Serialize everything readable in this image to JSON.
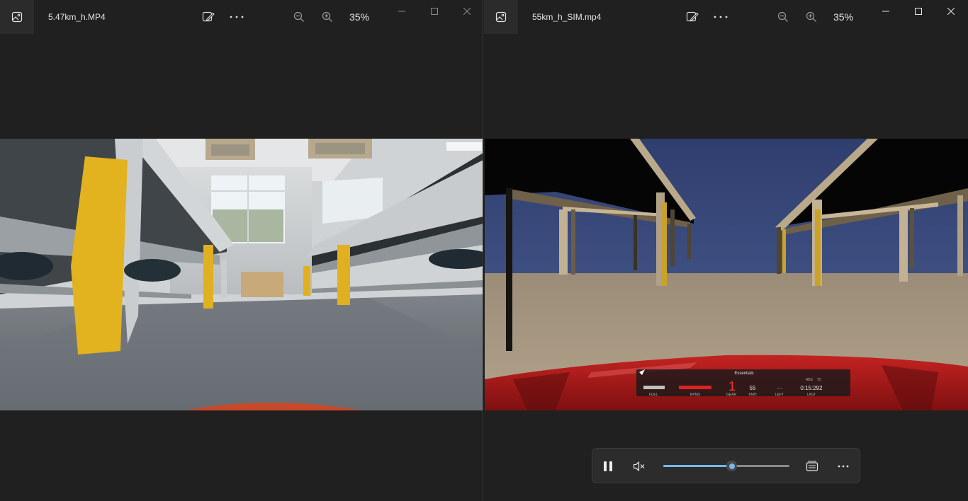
{
  "left_window": {
    "title": "5.47km_h.MP4",
    "zoom": "35%"
  },
  "right_window": {
    "title": "55km_h_SIM.mp4",
    "zoom": "35%",
    "hud": {
      "header": "Essentials",
      "gear": "1",
      "speed": "55",
      "left": "---",
      "lap_time": "0:15:292",
      "abs_label": "ABS",
      "tc_label": "TC",
      "fuel_label": "FUEL",
      "rpms_label": "RPMS",
      "gear_label": "GEAR",
      "kmh_label": "KMH",
      "left_label": "LEFT",
      "last_label": "LAST"
    }
  },
  "player": {
    "progress": 0.54
  },
  "icons": {
    "app": "photos-app-icon",
    "edit": "edit-image-icon",
    "more": "more-options-icon",
    "zoom_out": "zoom-out-icon",
    "zoom_in": "zoom-in-icon",
    "pause": "pause-icon",
    "mute": "volume-muted-icon",
    "captions": "captions-icon"
  },
  "colors": {
    "accent": "#76b9ed",
    "background": "#202020",
    "hud_red": "#ff2d2d"
  }
}
